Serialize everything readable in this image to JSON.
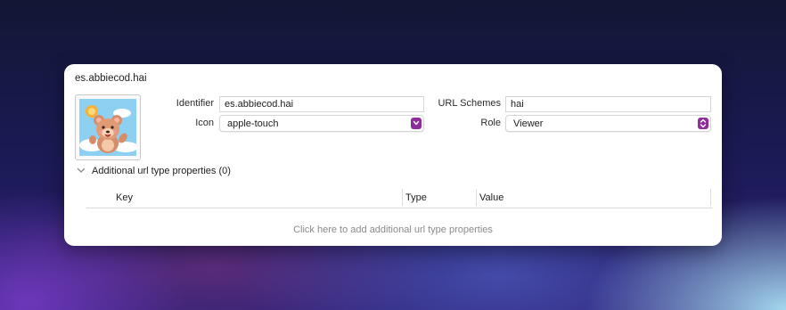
{
  "panel": {
    "title": "es.abbiecod.hai"
  },
  "identifier": {
    "label": "Identifier",
    "value": "es.abbiecod.hai"
  },
  "icon": {
    "label": "Icon",
    "selected": "apple-touch"
  },
  "url_schemes": {
    "label": "URL Schemes",
    "value": "hai"
  },
  "role": {
    "label": "Role",
    "selected": "Viewer"
  },
  "additional": {
    "label": "Additional url type properties (0)"
  },
  "table": {
    "columns": [
      "Key",
      "Type",
      "Value"
    ],
    "empty_hint": "Click here to add additional url type properties"
  },
  "colors": {
    "popup_accent": "#8e2c9c"
  }
}
